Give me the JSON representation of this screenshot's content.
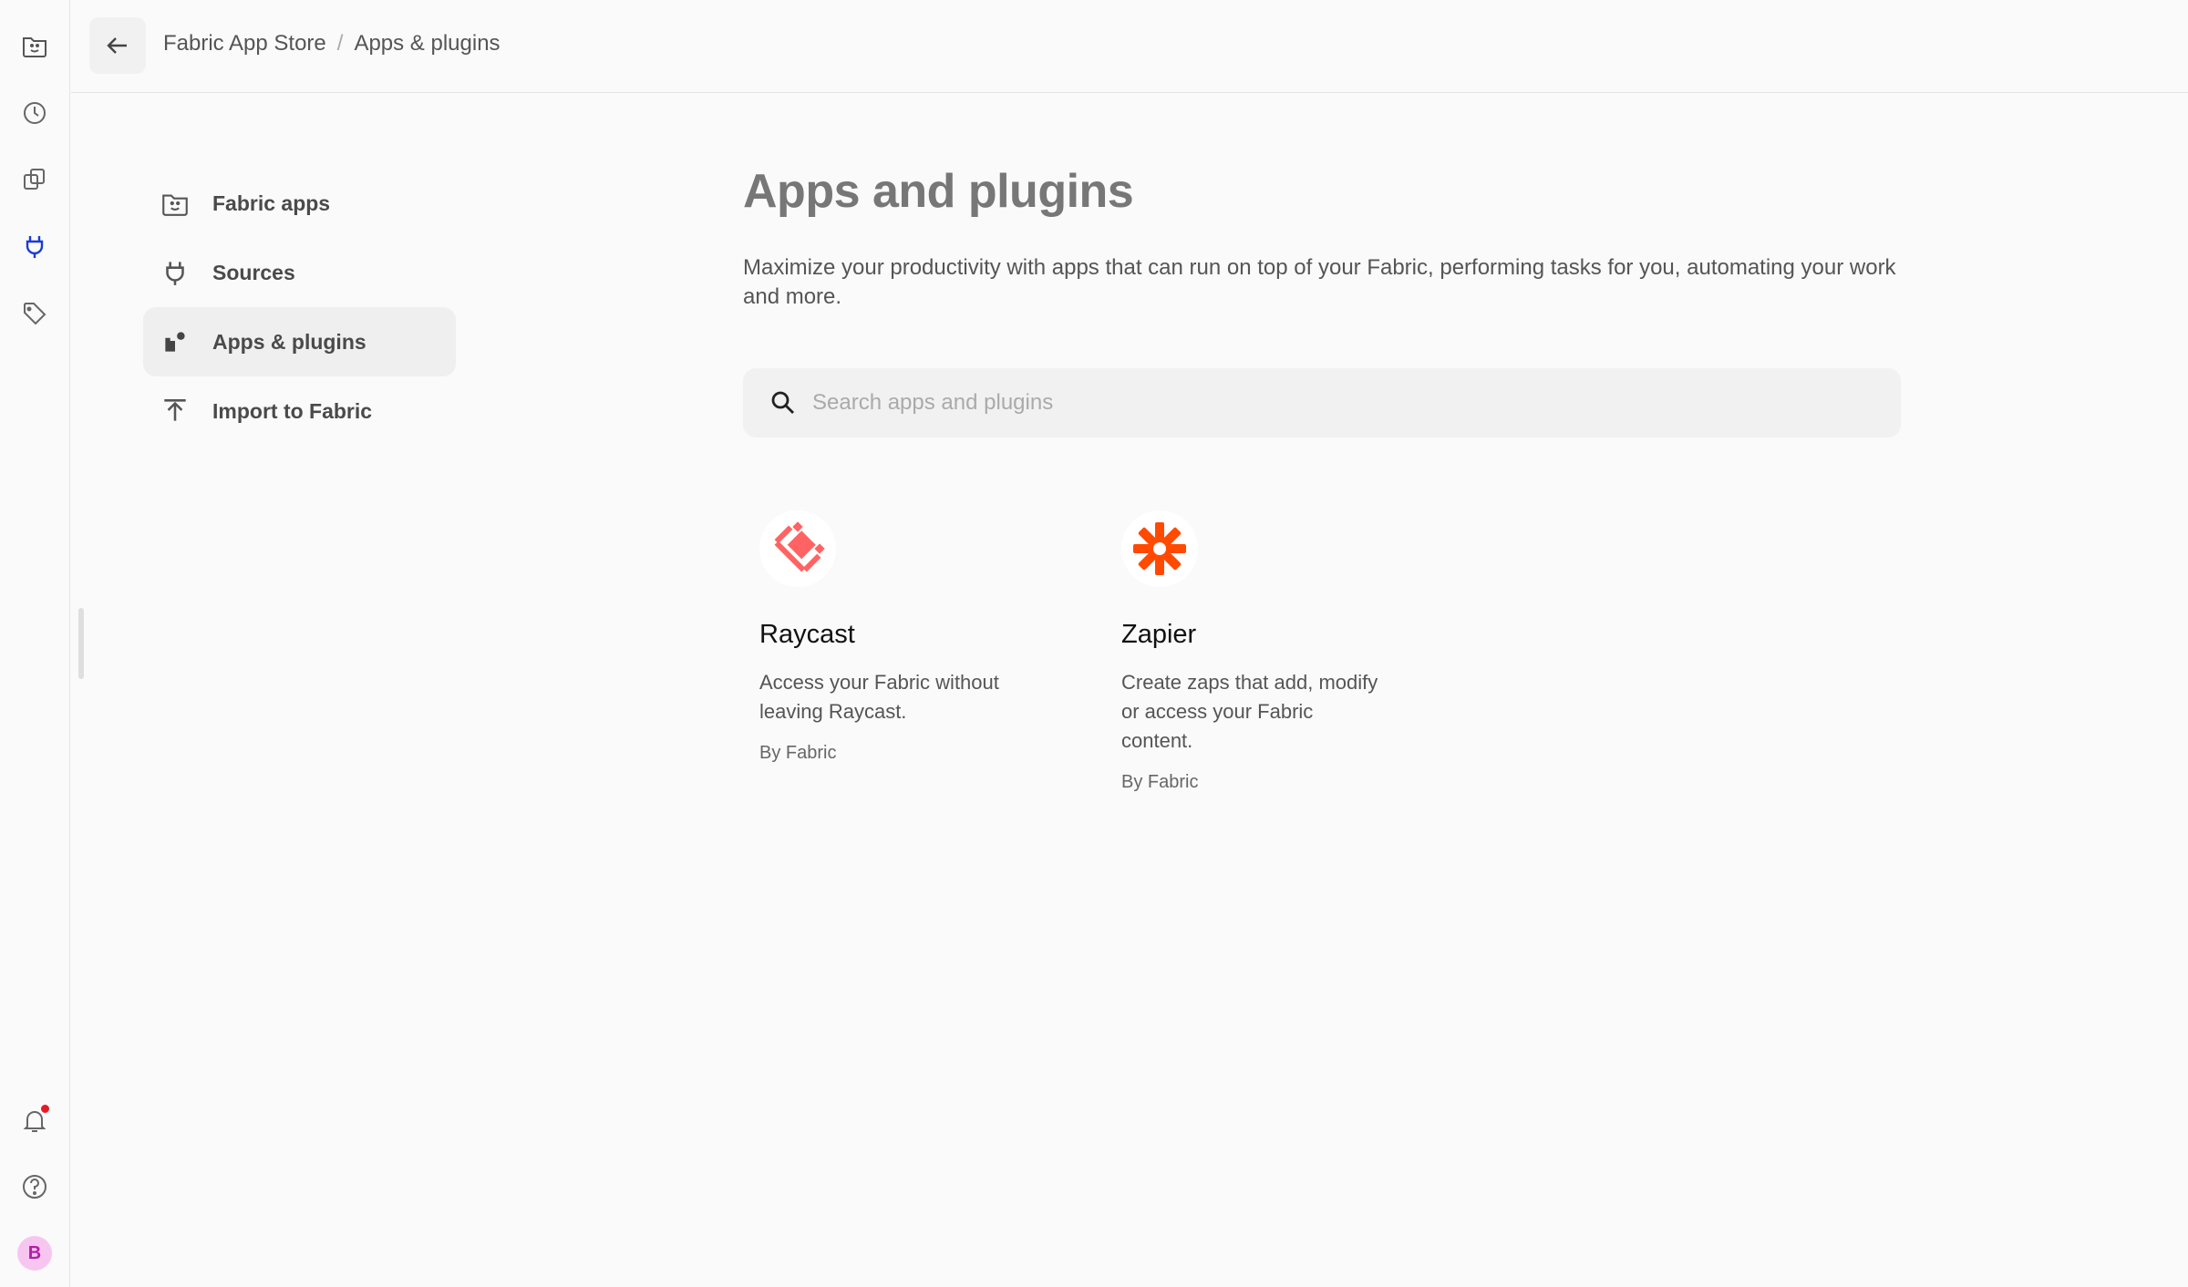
{
  "rail": {
    "icons": [
      "fabric-logo-icon",
      "history-icon",
      "copy-icon",
      "plug-icon",
      "tag-icon",
      "bell-icon",
      "help-icon"
    ],
    "active_color": "#1a3bd8",
    "avatar_initial": "B"
  },
  "breadcrumb": {
    "root": "Fabric App Store",
    "separator": "/",
    "current": "Apps & plugins"
  },
  "nav": {
    "items": [
      {
        "label": "Fabric apps",
        "icon": "fabric-logo-icon"
      },
      {
        "label": "Sources",
        "icon": "plug-icon"
      },
      {
        "label": "Apps & plugins",
        "icon": "apps-icon",
        "active": true
      },
      {
        "label": "Import to Fabric",
        "icon": "upload-icon"
      }
    ]
  },
  "main": {
    "title": "Apps and plugins",
    "description": "Maximize your productivity with apps that can run on top of your Fabric, performing tasks for you, automating your work and more.",
    "search": {
      "placeholder": "Search apps and plugins",
      "value": ""
    }
  },
  "apps": [
    {
      "name": "Raycast",
      "description": "Access your Fabric without leaving Raycast.",
      "author": "By Fabric",
      "icon": "raycast-logo-icon",
      "color": "#ff6363"
    },
    {
      "name": "Zapier",
      "description": "Create zaps that add, modify or access your Fabric content.",
      "author": "By Fabric",
      "icon": "zapier-logo-icon",
      "color": "#ff4a00"
    }
  ]
}
